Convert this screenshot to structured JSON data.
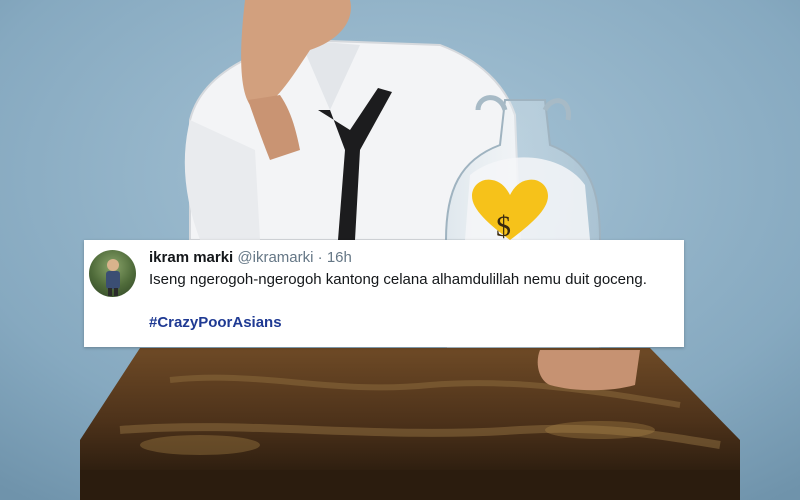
{
  "tweet": {
    "author_name": "ikram marki",
    "handle": "@ikramarki",
    "separator": "·",
    "time": "16h",
    "text": "Iseng ngerogoh-ngerogoh kantong celana alhamdulillah nemu duit goceng.",
    "hashtag": "#CrazyPoorAsians"
  },
  "jar_label": {
    "icon": "dollar-heart-sticker-icon",
    "symbol": "$"
  },
  "colors": {
    "wall": "#8fb2c9",
    "table": "#5a3b1e",
    "shirt": "#f3f4f6",
    "tie": "#1c1c1e",
    "sticker": "#f6c21a",
    "hashtag": "#1f3a93"
  }
}
